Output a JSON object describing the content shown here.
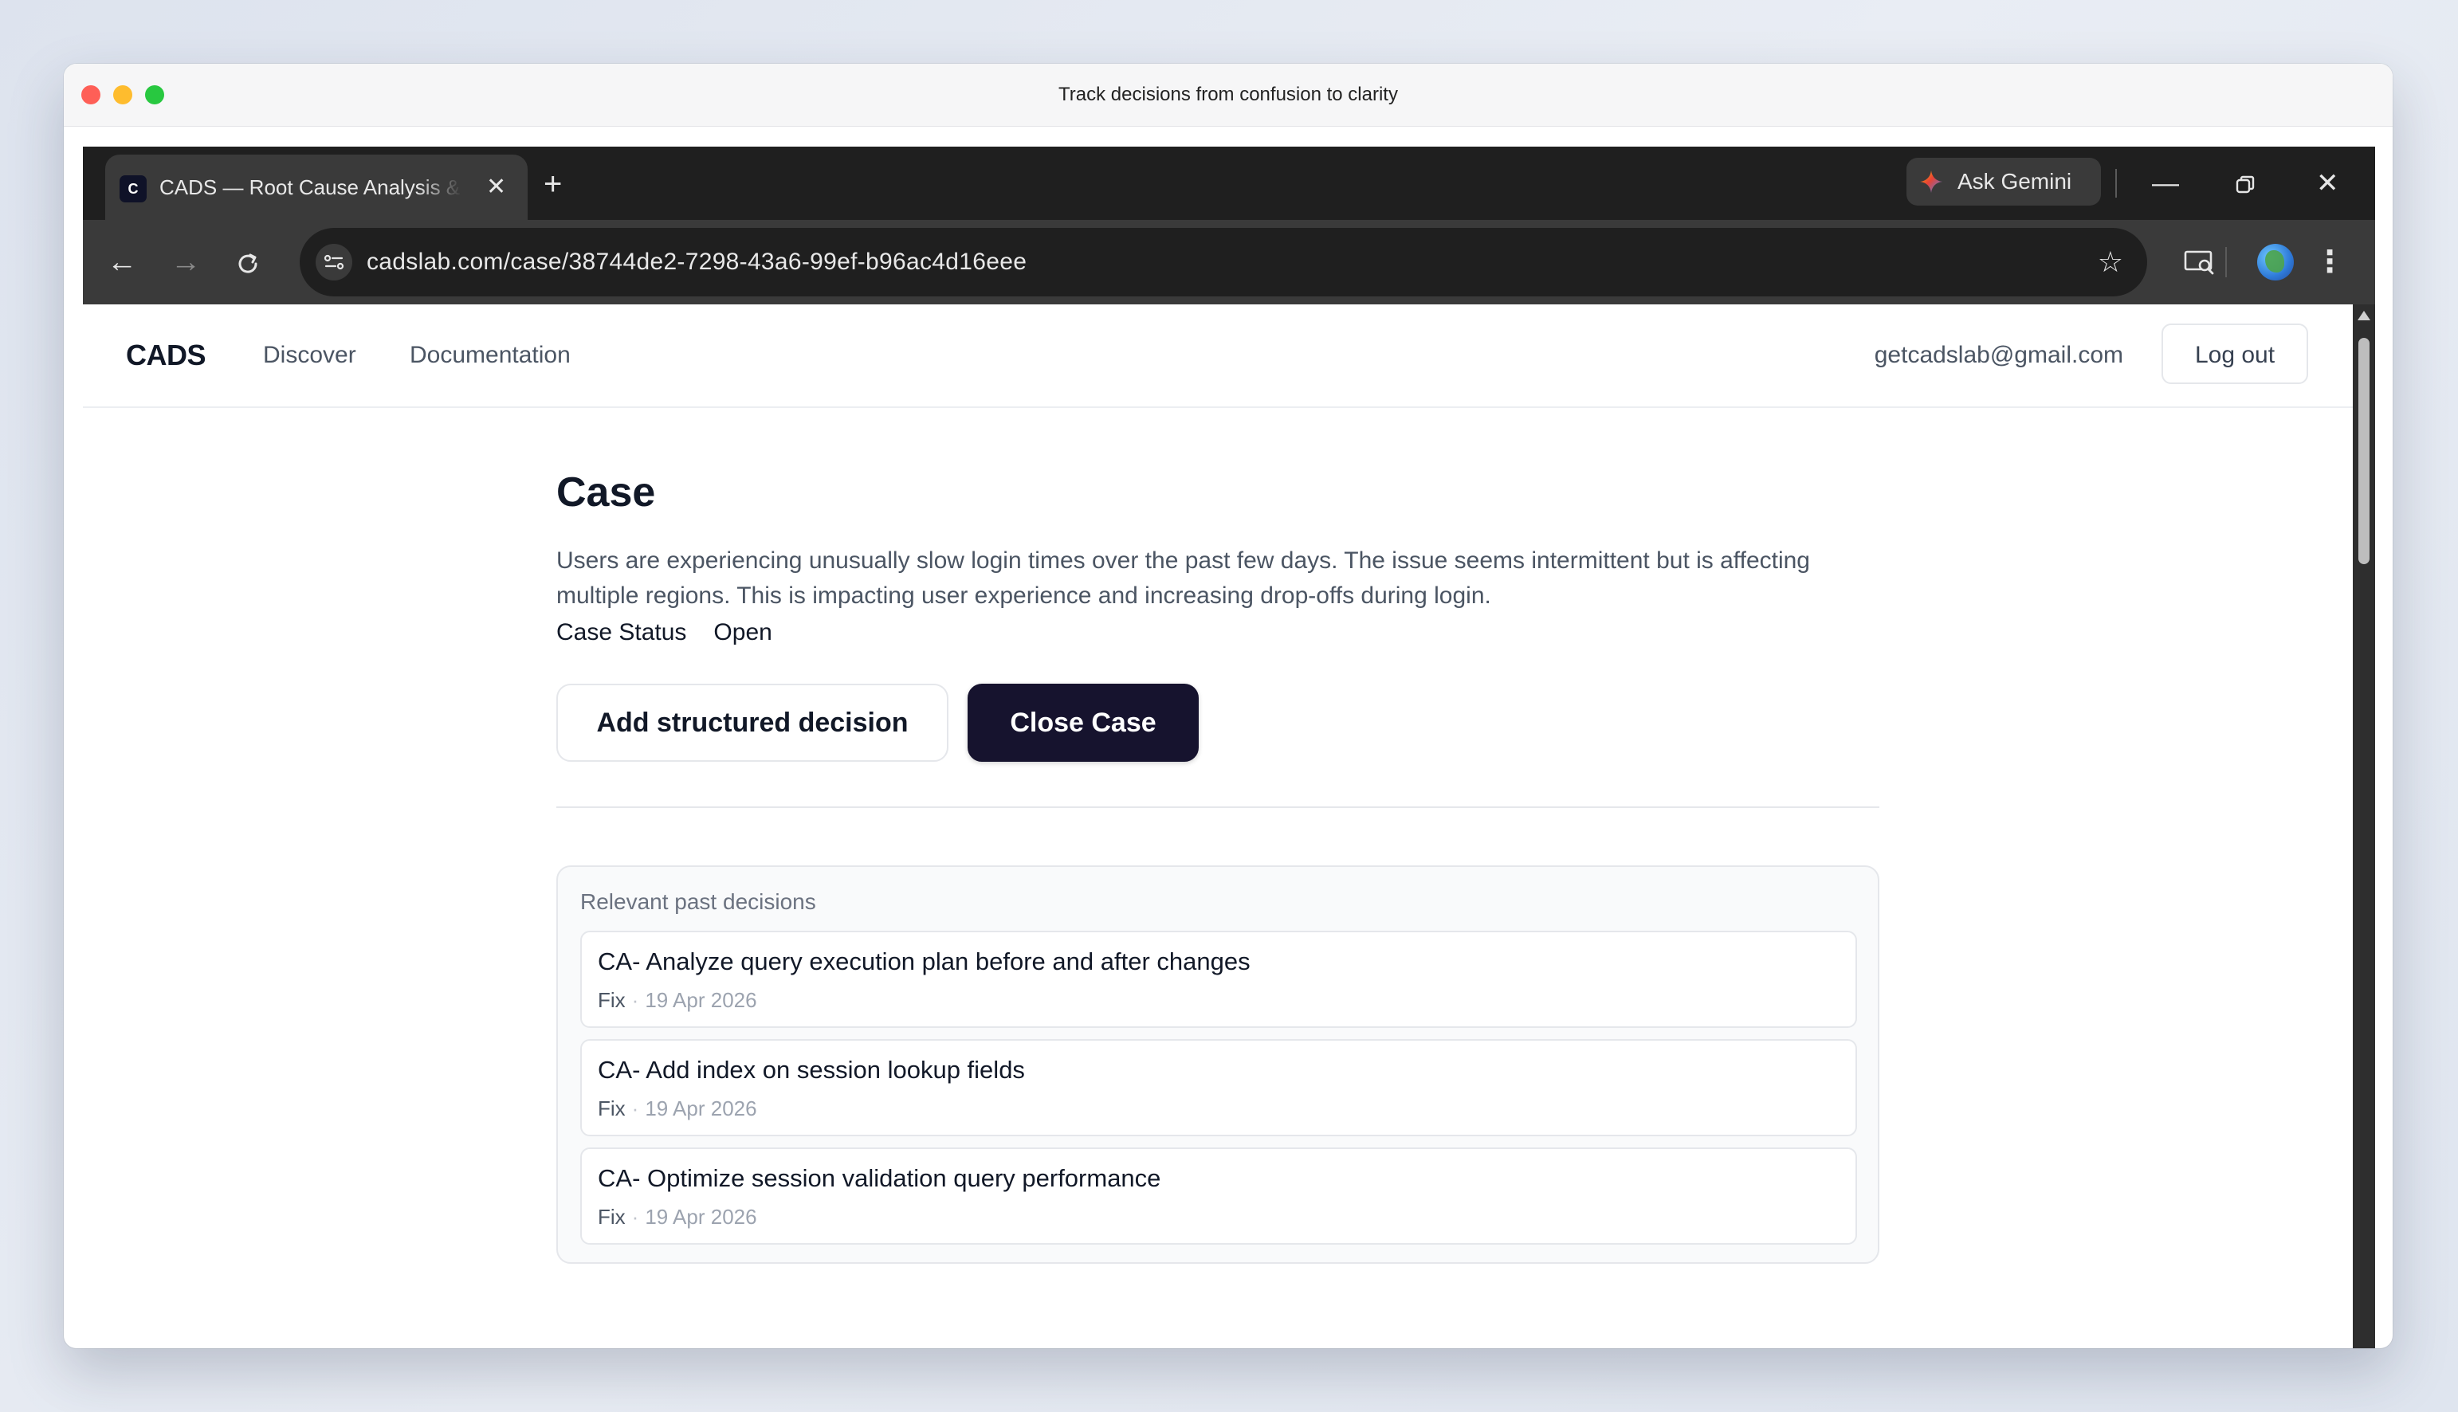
{
  "window": {
    "title": "Track decisions from confusion to clarity"
  },
  "browser": {
    "tab": {
      "favicon_letter": "C",
      "title": "CADS — Root Cause Analysis & Decision"
    },
    "new_tab_symbol": "+",
    "gemini_label": "Ask Gemini",
    "url": "cadslab.com/case/38744de2-7298-43a6-99ef-b96ac4d16eee"
  },
  "site": {
    "brand": "CADS",
    "nav": [
      "Discover",
      "Documentation"
    ],
    "user_email": "getcadslab@gmail.com",
    "logout_label": "Log out"
  },
  "case": {
    "heading": "Case",
    "description": "Users are experiencing unusually slow login times over the past few days. The issue seems intermittent but is affecting multiple regions. This is impacting user experience and increasing drop-offs during login.",
    "status_label": "Case Status",
    "status_value": "Open",
    "add_decision_label": "Add structured decision",
    "close_case_label": "Close Case"
  },
  "past_decisions": {
    "heading": "Relevant past decisions",
    "items": [
      {
        "title": "CA- Analyze query execution plan before and after changes",
        "type": "Fix",
        "separator": "·",
        "date": "19 Apr 2026"
      },
      {
        "title": "CA- Add index on session lookup fields",
        "type": "Fix",
        "separator": "·",
        "date": "19 Apr 2026"
      },
      {
        "title": "CA- Optimize session validation query performance",
        "type": "Fix",
        "separator": "·",
        "date": "19 Apr 2026"
      }
    ]
  },
  "colors": {
    "primary_button": "#16132e",
    "browser_dark": "#1f1f1f",
    "toolbar": "#3a3a3a",
    "traffic_red": "#fe5f57",
    "traffic_yellow": "#febc2e",
    "traffic_green": "#28c840"
  },
  "icons": [
    "back-arrow-icon",
    "forward-arrow-icon",
    "reload-icon",
    "site-settings-icon",
    "bookmark-star-icon",
    "cast-search-icon",
    "profile-avatar-icon",
    "kebab-menu-icon",
    "gemini-sparkle-icon",
    "minimize-icon",
    "restore-icon",
    "close-window-icon",
    "tab-close-icon"
  ]
}
